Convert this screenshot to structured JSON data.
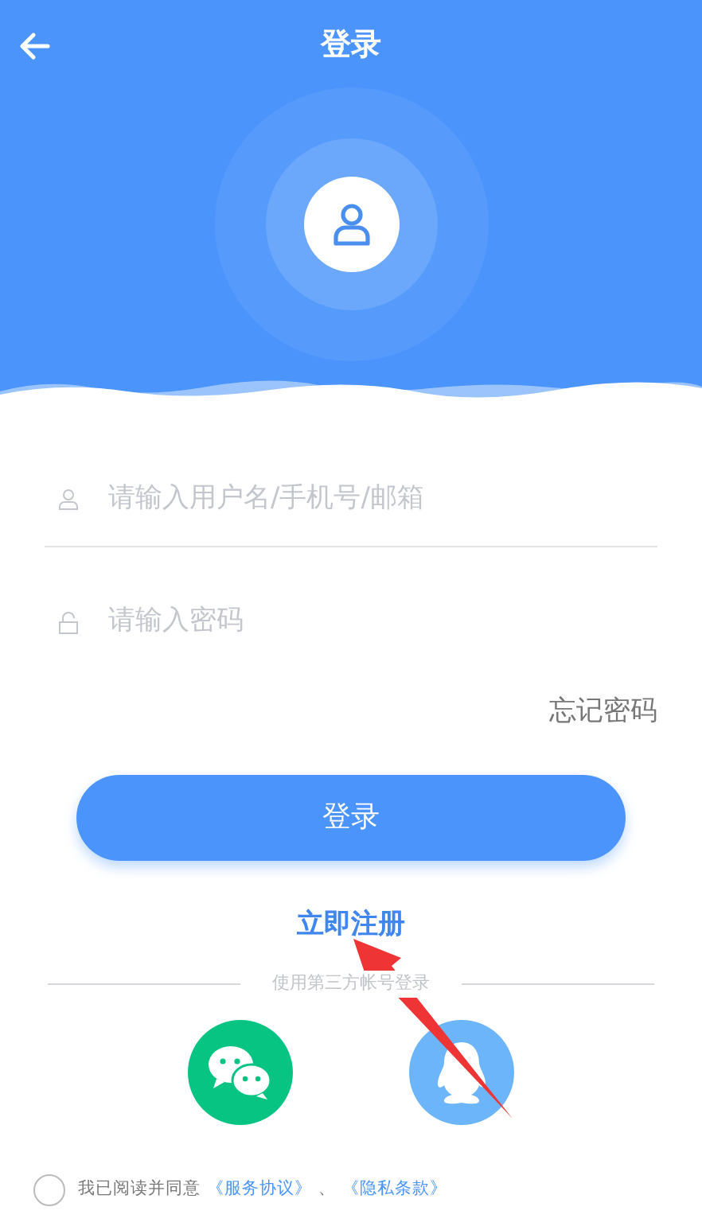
{
  "header": {
    "title": "登录"
  },
  "fields": [
    {
      "kind": "user",
      "placeholder": "请输入用户名/手机号/邮箱",
      "underline": true
    },
    {
      "kind": "lock",
      "placeholder": "请输入密码",
      "underline": false
    }
  ],
  "forgot_link": "忘记密码",
  "login_button": "登录",
  "register_link": "立即注册",
  "divider_text": "使用第三方帐号登录",
  "social": [
    {
      "kind": "wechat",
      "color": "#08c483"
    },
    {
      "kind": "qq",
      "color": "#6cb5fb"
    }
  ],
  "agreement": {
    "checked": false,
    "text": "我已阅读并同意",
    "links": [
      "《服务协议》",
      "《隐私条款》"
    ],
    "separator": "、"
  },
  "annotation": {
    "kind": "arrow"
  }
}
